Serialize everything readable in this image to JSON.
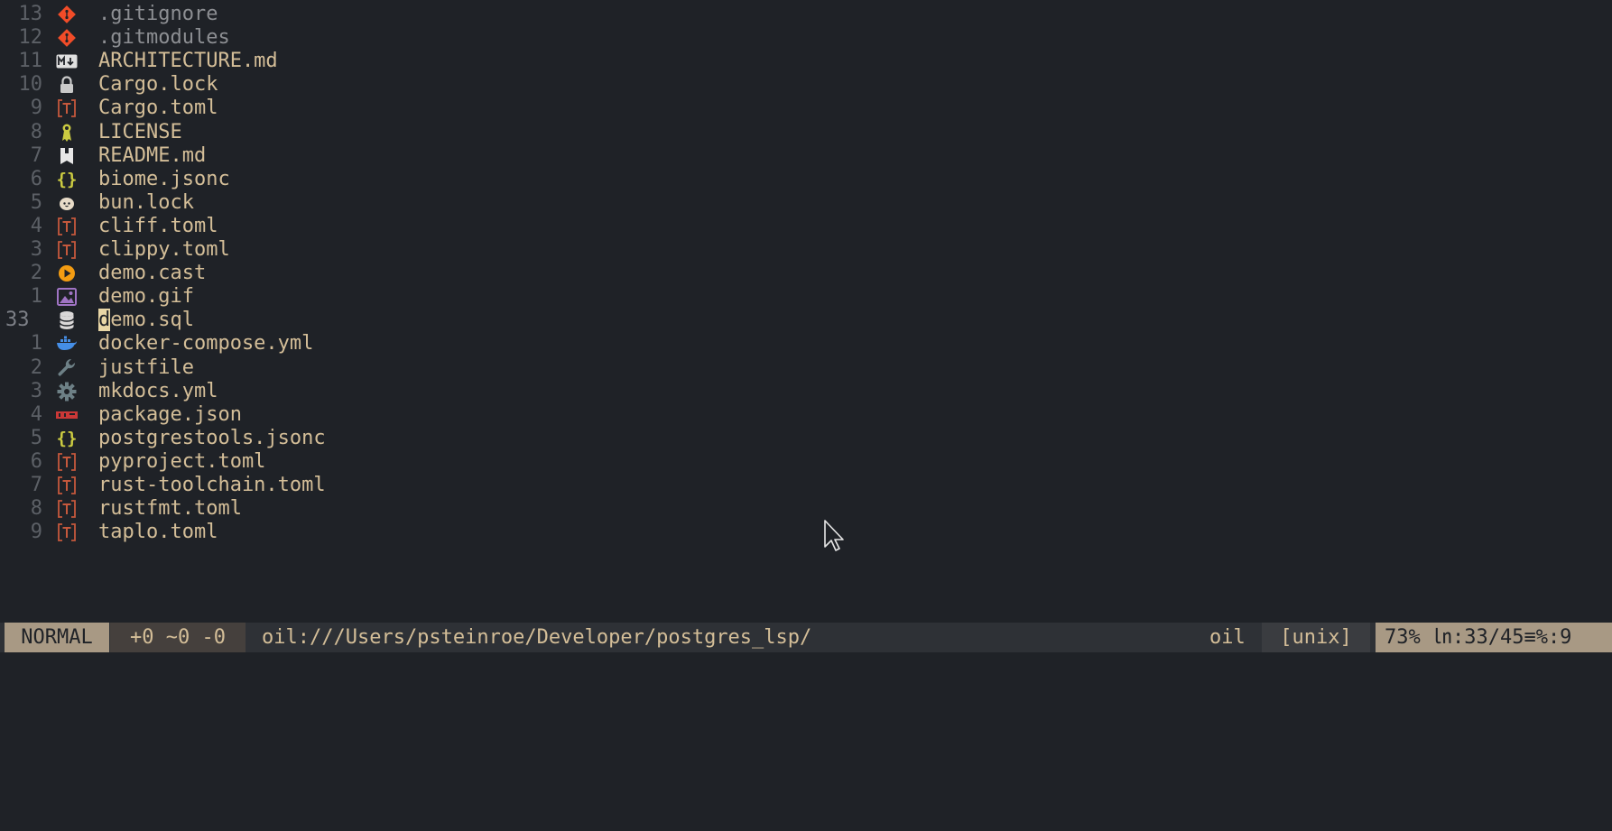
{
  "editor": {
    "entries": [
      {
        "line": "13",
        "icon": "git-icon",
        "name": ".gitignore",
        "current": false
      },
      {
        "line": "12",
        "icon": "git-icon",
        "name": ".gitmodules",
        "current": false
      },
      {
        "line": "11",
        "icon": "markdown-icon",
        "name": "ARCHITECTURE.md",
        "current": false
      },
      {
        "line": "10",
        "icon": "lock-icon",
        "name": "Cargo.lock",
        "current": false
      },
      {
        "line": "9",
        "icon": "toml-icon",
        "name": "Cargo.toml",
        "current": false
      },
      {
        "line": "8",
        "icon": "license-icon",
        "name": "LICENSE",
        "current": false
      },
      {
        "line": "7",
        "icon": "readme-icon",
        "name": "README.md",
        "current": false
      },
      {
        "line": "6",
        "icon": "json-icon",
        "name": "biome.jsonc",
        "current": false
      },
      {
        "line": "5",
        "icon": "bun-icon",
        "name": "bun.lock",
        "current": false
      },
      {
        "line": "4",
        "icon": "toml-icon",
        "name": "cliff.toml",
        "current": false
      },
      {
        "line": "3",
        "icon": "toml-icon",
        "name": "clippy.toml",
        "current": false
      },
      {
        "line": "2",
        "icon": "play-icon",
        "name": "demo.cast",
        "current": false
      },
      {
        "line": "1",
        "icon": "image-icon",
        "name": "demo.gif",
        "current": false
      },
      {
        "line": "33",
        "icon": "database-icon",
        "name": "demo.sql",
        "current": true
      },
      {
        "line": "1",
        "icon": "docker-icon",
        "name": "docker-compose.yml",
        "current": false
      },
      {
        "line": "2",
        "icon": "wrench-icon",
        "name": "justfile",
        "current": false
      },
      {
        "line": "3",
        "icon": "gear-icon",
        "name": "mkdocs.yml",
        "current": false
      },
      {
        "line": "4",
        "icon": "npm-icon",
        "name": "package.json",
        "current": false
      },
      {
        "line": "5",
        "icon": "json-icon",
        "name": "postgrestools.jsonc",
        "current": false
      },
      {
        "line": "6",
        "icon": "toml-icon",
        "name": "pyproject.toml",
        "current": false
      },
      {
        "line": "7",
        "icon": "toml-icon",
        "name": "rust-toolchain.toml",
        "current": false
      },
      {
        "line": "8",
        "icon": "toml-icon",
        "name": "rustfmt.toml",
        "current": false
      },
      {
        "line": "9",
        "icon": "toml-icon",
        "name": "taplo.toml",
        "current": false
      }
    ]
  },
  "statusline": {
    "mode": "NORMAL",
    "diff": "+0 ~0 -0",
    "path": "oil:///Users/psteinroe/Developer/postgres_lsp/",
    "filetype": "oil",
    "fileformat": "[unix]",
    "position": "73% ㏑:33/45≡%:9"
  },
  "colors": {
    "background": "#1f2227",
    "foreground": "#d4be98",
    "line_number": "#5c6066",
    "mode_bg": "#a89984",
    "toml": "#c5583c",
    "json": "#cbcb41",
    "git": "#f14c28"
  }
}
